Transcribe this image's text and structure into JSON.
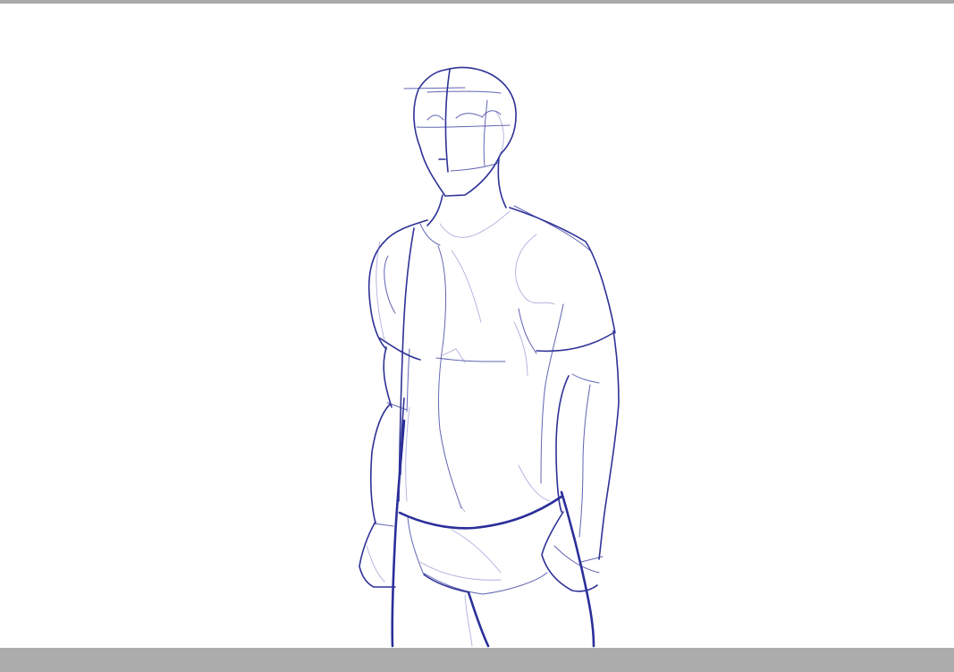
{
  "window": {
    "top_bar_color": "#a9a9a9",
    "bottom_bar_color": "#acacac",
    "canvas_background": "#ffffff"
  },
  "artwork": {
    "ink_color": "#2b2f9a",
    "subject": "figure-sketch-icon"
  }
}
